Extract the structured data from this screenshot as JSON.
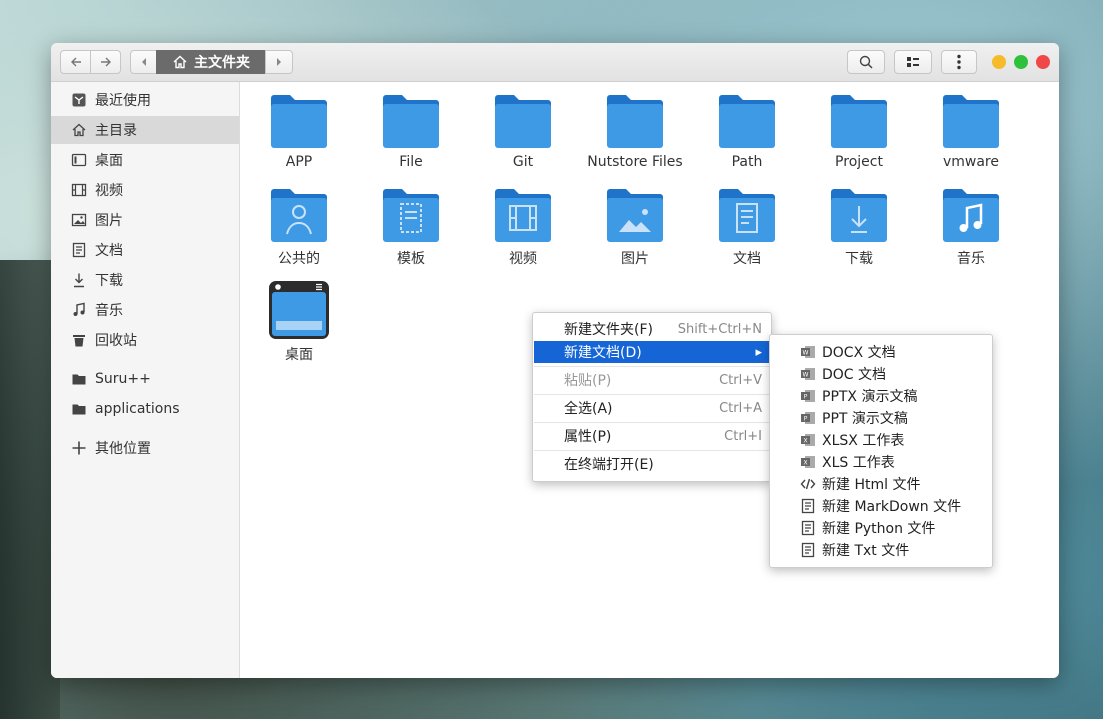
{
  "window": {
    "path_crumb": "主文件夹"
  },
  "sidebar": {
    "items": [
      {
        "label": "最近使用",
        "icon": "recent-icon"
      },
      {
        "label": "主目录",
        "icon": "home-icon"
      },
      {
        "label": "桌面",
        "icon": "desktop-icon"
      },
      {
        "label": "视频",
        "icon": "video-icon"
      },
      {
        "label": "图片",
        "icon": "picture-icon"
      },
      {
        "label": "文档",
        "icon": "document-icon"
      },
      {
        "label": "下载",
        "icon": "download-icon"
      },
      {
        "label": "音乐",
        "icon": "music-icon"
      },
      {
        "label": "回收站",
        "icon": "trash-icon"
      },
      {
        "label": "Suru++",
        "icon": "folder-icon"
      },
      {
        "label": "applications",
        "icon": "folder-icon"
      },
      {
        "label": "其他位置",
        "icon": "plus-icon"
      }
    ]
  },
  "files": [
    {
      "label": "APP",
      "icon": "folder-icon"
    },
    {
      "label": "File",
      "icon": "folder-icon"
    },
    {
      "label": "Git",
      "icon": "folder-icon"
    },
    {
      "label": "Nutstore Files",
      "icon": "folder-icon"
    },
    {
      "label": "Path",
      "icon": "folder-icon"
    },
    {
      "label": "Project",
      "icon": "folder-icon"
    },
    {
      "label": "vmware",
      "icon": "folder-icon"
    },
    {
      "label": "公共的",
      "icon": "folder-public-icon"
    },
    {
      "label": "模板",
      "icon": "folder-templates-icon"
    },
    {
      "label": "视频",
      "icon": "folder-videos-icon"
    },
    {
      "label": "图片",
      "icon": "folder-pictures-icon"
    },
    {
      "label": "文档",
      "icon": "folder-documents-icon"
    },
    {
      "label": "下载",
      "icon": "folder-download-icon"
    },
    {
      "label": "音乐",
      "icon": "folder-music-icon"
    },
    {
      "label": "桌面",
      "icon": "desktop-app-icon"
    }
  ],
  "context_menu": {
    "items": [
      {
        "label": "新建文件夹(F)",
        "shortcut": "Shift+Ctrl+N"
      },
      {
        "label": "新建文档(D)",
        "shortcut": ""
      },
      {
        "label": "粘贴(P)",
        "shortcut": "Ctrl+V"
      },
      {
        "label": "全选(A)",
        "shortcut": "Ctrl+A"
      },
      {
        "label": "属性(P)",
        "shortcut": "Ctrl+I"
      },
      {
        "label": "在终端打开(E)",
        "shortcut": ""
      }
    ]
  },
  "submenu": {
    "items": [
      {
        "label": "DOCX 文档",
        "icon": "word-icon"
      },
      {
        "label": "DOC 文档",
        "icon": "word-icon"
      },
      {
        "label": "PPTX 演示文稿",
        "icon": "powerpoint-icon"
      },
      {
        "label": "PPT 演示文稿",
        "icon": "powerpoint-icon"
      },
      {
        "label": "XLSX 工作表",
        "icon": "excel-icon"
      },
      {
        "label": "XLS 工作表",
        "icon": "excel-icon"
      },
      {
        "label": "新建 Html 文件",
        "icon": "code-icon"
      },
      {
        "label": "新建 MarkDown 文件",
        "icon": "text-file-icon"
      },
      {
        "label": "新建 Python 文件",
        "icon": "text-file-icon"
      },
      {
        "label": "新建 Txt 文件",
        "icon": "text-file-icon"
      }
    ]
  },
  "colors": {
    "folder": "#3f9ae6",
    "folder_tab": "#1f74c9",
    "highlight": "#1565d6"
  }
}
